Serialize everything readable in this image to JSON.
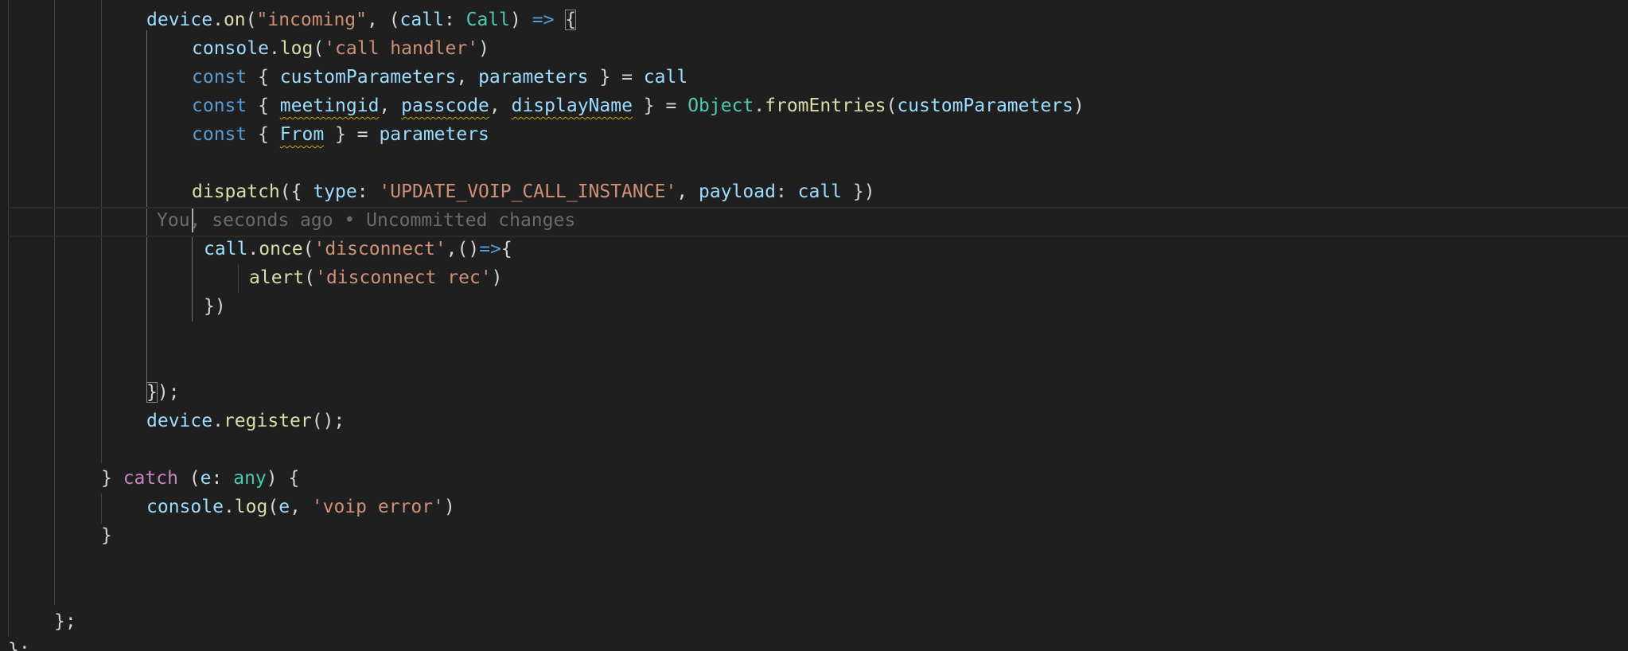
{
  "editor": {
    "lines": {
      "l1": {
        "device": "device",
        "dot": ".",
        "on": "on",
        "open": "(",
        "event": "\"incoming\"",
        "comma": ", (",
        "param": "call",
        "colon": ": ",
        "type": "Call",
        "close": ") ",
        "arrow": "=>",
        "brace": "{"
      },
      "l2": {
        "console": "console",
        "dot": ".",
        "log": "log",
        "open": "(",
        "str": "'call handler'",
        "close": ")"
      },
      "l3": {
        "const": "const",
        "open": " { ",
        "a": "customParameters",
        "sep": ", ",
        "b": "parameters",
        "close": " } = ",
        "call": "call"
      },
      "l4": {
        "const": "const",
        "open": " { ",
        "a": "meetingid",
        "sep1": ", ",
        "b": "passcode",
        "sep2": ", ",
        "c": "displayName",
        "close": " } = ",
        "obj": "Object",
        "dot": ".",
        "fn": "fromEntries",
        "p1": "(",
        "arg": "customParameters",
        "p2": ")"
      },
      "l5": {
        "const": "const",
        "open": " { ",
        "a": "From",
        "close": " } = ",
        "src": "parameters"
      },
      "l6": {
        "fn": "dispatch",
        "open": "({ ",
        "k1": "type",
        "c1": ": ",
        "v1": "'UPDATE_VOIP_CALL_INSTANCE'",
        "sep": ", ",
        "k2": "payload",
        "c2": ": ",
        "v2": "call",
        "close": " })"
      },
      "blame": "You, seconds ago • Uncommitted changes",
      "l8": {
        "call": "call",
        "dot": ".",
        "once": "once",
        "open": "(",
        "str": "'disconnect'",
        "mid": ",()",
        "arrow": "=>",
        "brace": "{"
      },
      "l9": {
        "fn": "alert",
        "open": "(",
        "str": "'disconnect rec'",
        "close": ")"
      },
      "l10": {
        "text": "})"
      },
      "l13": {
        "brace": "}",
        "rest": ");"
      },
      "l14": {
        "device": "device",
        "dot": ".",
        "fn": "register",
        "rest": "();"
      },
      "l16": {
        "a": "} ",
        "catch": "catch",
        "b": " (",
        "e": "e",
        "c": ": ",
        "any": "any",
        "d": ") {"
      },
      "l17": {
        "console": "console",
        "dot": ".",
        "log": "log",
        "open": "(",
        "e": "e",
        "sep": ", ",
        "str": "'voip error'",
        "close": ")"
      },
      "l18": {
        "text": "}"
      },
      "l21": {
        "text": "};"
      },
      "l22": {
        "text": "};"
      }
    }
  }
}
